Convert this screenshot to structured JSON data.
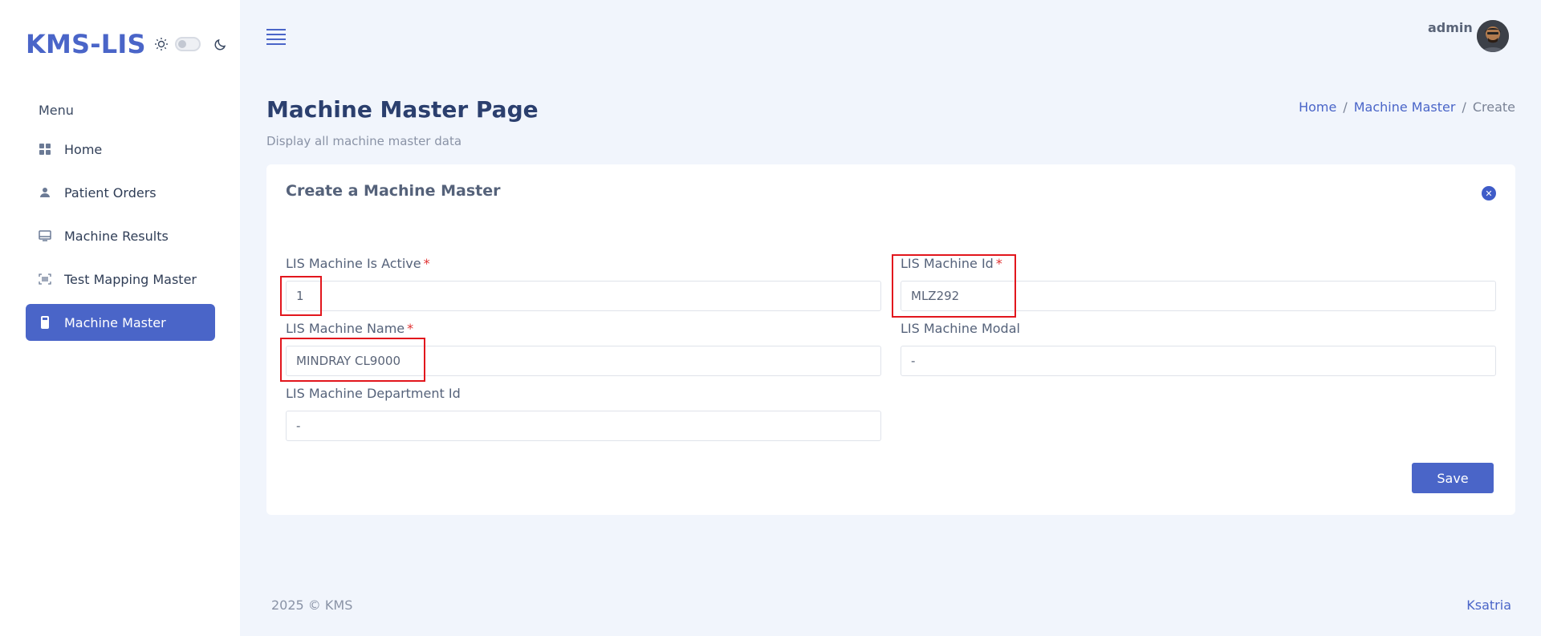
{
  "brand": {
    "title": "KMS-LIS"
  },
  "sidebar": {
    "menu_heading": "Menu",
    "items": [
      {
        "label": "Home",
        "icon": "grid-icon"
      },
      {
        "label": "Patient Orders",
        "icon": "user-icon"
      },
      {
        "label": "Machine Results",
        "icon": "monitor-icon"
      },
      {
        "label": "Test Mapping Master",
        "icon": "barcode-scan-icon"
      },
      {
        "label": "Machine Master",
        "icon": "device-icon",
        "active": true
      }
    ]
  },
  "topbar": {
    "user_name": "admin"
  },
  "page": {
    "title": "Machine Master Page",
    "subtitle": "Display all machine master data",
    "breadcrumb": [
      "Home",
      "Machine Master",
      "Create"
    ]
  },
  "form": {
    "title": "Create a Machine Master",
    "fields": {
      "is_active": {
        "label": "LIS Machine Is Active",
        "value": "1",
        "required": "*"
      },
      "machine_id": {
        "label": "LIS Machine Id",
        "value": "MLZ292",
        "required": "*"
      },
      "machine_name": {
        "label": "LIS Machine Name",
        "value": "MINDRAY CL9000",
        "required": "*"
      },
      "machine_modal": {
        "label": "LIS Machine Modal",
        "value": "-"
      },
      "department_id": {
        "label": "LIS Machine Department Id",
        "value": "-"
      }
    },
    "save_label": "Save"
  },
  "footer": {
    "left": "2025 © KMS",
    "right": "Ksatria"
  },
  "colors": {
    "accent": "#4a65c8",
    "highlight": "#e2161d",
    "background": "#f1f5fc"
  }
}
